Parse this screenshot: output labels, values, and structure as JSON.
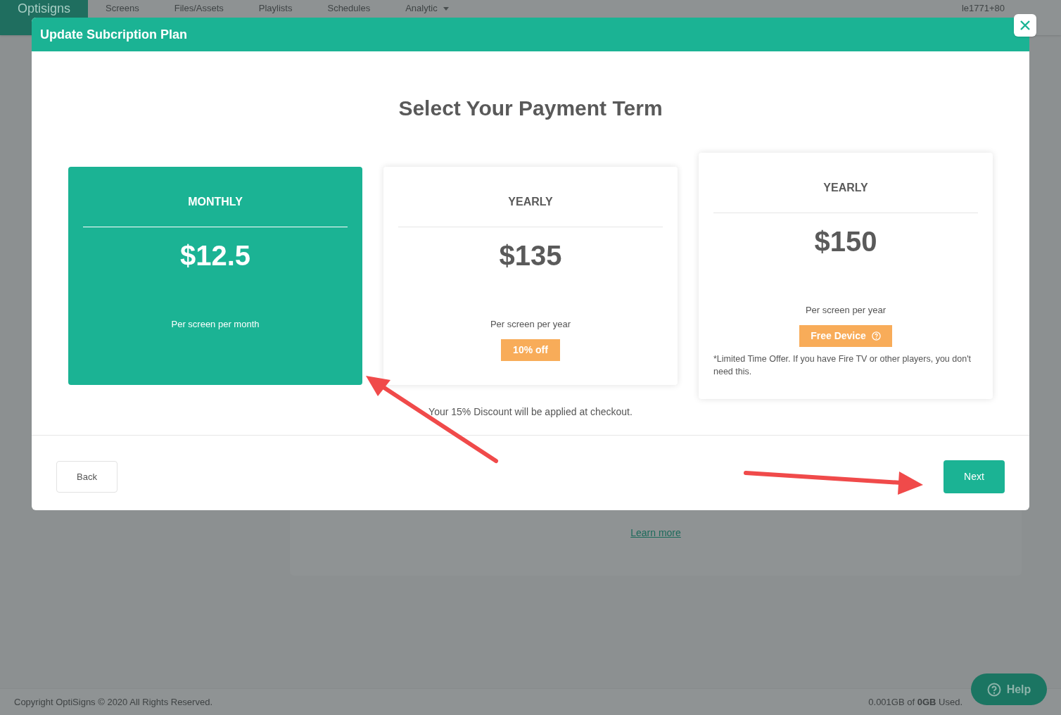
{
  "app": {
    "logo": "Optisigns",
    "nav": [
      {
        "label": "Screens",
        "kind": "link"
      },
      {
        "label": "Files/Assets",
        "kind": "link"
      },
      {
        "label": "Playlists",
        "kind": "link"
      },
      {
        "label": "Schedules",
        "kind": "link"
      },
      {
        "label": "Analytic",
        "kind": "dropdown"
      }
    ],
    "user": "le1771+80"
  },
  "background": {
    "link": "Learn more"
  },
  "footer": {
    "copyright": "Copyright OptiSigns © 2020 All Rights Reserved.",
    "storage": "0.001GB of **0GB** Used.",
    "help": "Help"
  },
  "modal": {
    "title": "Update Subcription Plan",
    "heading": "Select Your Payment Term",
    "plans": [
      {
        "term": "MONTHLY",
        "price": "$12.5",
        "note": "Per screen per month",
        "selected": true
      },
      {
        "term": "YEARLY",
        "price": "$135",
        "note": "Per screen per year",
        "selected": false,
        "badge": {
          "label": "10% off",
          "info": false
        }
      },
      {
        "term": "YEARLY",
        "price": "$150",
        "note": "Per screen per year",
        "selected": false,
        "badge": {
          "label": "Free Device",
          "info": true
        },
        "footnote": "*Limited Time Offer. If you have Fire TV or other players, you don't need this."
      }
    ],
    "discount_note": "Your 15% Discount will be applied at checkout.",
    "back": "Back",
    "next": "Next"
  }
}
